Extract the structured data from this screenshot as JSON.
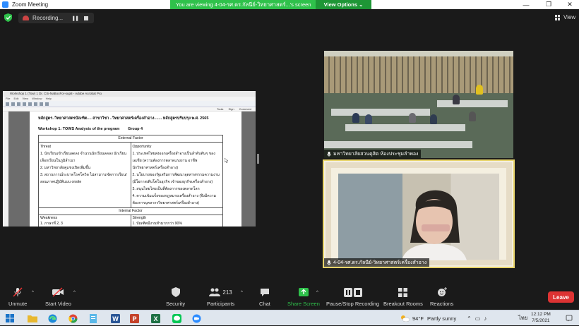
{
  "window": {
    "title": "Zoom Meeting"
  },
  "window_controls": {
    "minimize": "—",
    "restore": "❐",
    "close": "✕"
  },
  "share_banner": {
    "text": "You are viewing 4-04-รศ.ดร.กัลนีย์-วิทยาศาสตร์...'s screen",
    "view_options": "View Options ⌄"
  },
  "recording": {
    "label": "Recording..."
  },
  "view_button": {
    "label": "View"
  },
  "shared_document": {
    "app_title": "Workshop 1 (Tow) 1 Dr. CSi-NaBoxFor-sup8 - Adobe Acrobat Pro",
    "menu": "File Edit View Window Help",
    "tools_bar": "Tools Sign Comment",
    "heading": "หลักสูตร..วิทยาศาสตรบัณฑิต....  สาขาวิชา ..วิทยาศาสตร์เครื่องสำอาง.......  หลักสูตรปรับปรุง พ.ศ. 2565",
    "workshop_title": "Workshop 1: TOWS Analysis of the program",
    "group": "Group 4",
    "external_factor": "External Factor",
    "internal_factor": "Internal Factor",
    "threat_title": "Threat",
    "threat_items": [
      "1. นักเรียนเข้าเรียนลดลง จำนวนนักเรียนลดลง นักเรียน",
      "เลือกเรียนในภูมิลำเนา",
      "2. มหาวิทยาลัยคู่แข่งเปิดเพิ่มขึ้น",
      "3. สถานการณ์ระบาดโรคโควิด ไม่สามารถจัดการเรียน/",
      "สอนภาคปฏิบัติแบบ onsite"
    ],
    "opportunity_title": "Opportunity",
    "opportunity_items": [
      "1. ประเทศไทยส่งออกเครื่องสำอางเป็นลำดับต้นๆ ของ",
      "เอเชีย (ความต้องการตลาดแรงงาน อาชีพ",
      "นักวิทยาศาสตร์เครื่องสำอาง)",
      "2. นโยบายของรัฐเสริมการพัฒนาอุตสาหกรรมความงาม",
      "(มีโอกาสเติบโตในธุรกิจ เจ้าของธุรกิจเครื่องสำอาง)",
      "3. สนุนไทยไทยเป็นที่ต้องการของตลาดโลก",
      "4. ความเข้มแข็งของกฎหมายเครื่องสำอาง (จึงมีความ",
      "ต้องการบุคลากรวิทยาศาสตร์เครื่องสำอาง)"
    ],
    "weakness_title": "Weakness",
    "weakness_first": "1. ภาษาที่ 2, 3",
    "strength_title": "Strength",
    "strength_first": "1. บัณฑิตมีงานทำมากกว่า 90%"
  },
  "participants_video": [
    {
      "name": "มหาวิทยาลัยสวนดุสิต ห้องประชุมลำพอง"
    },
    {
      "name": "4-04-รศ.ดร.กัลนีย์-วิทยาศาสตร์เครื่องสำอาง"
    }
  ],
  "toolbar": {
    "unmute": "Unmute",
    "start_video": "Start Video",
    "security": "Security",
    "participants": "Participants",
    "participants_count": "213",
    "chat": "Chat",
    "share_screen": "Share Screen",
    "recording": "Pause/Stop Recording",
    "breakout": "Breakout Rooms",
    "reactions": "Reactions",
    "leave": "Leave"
  },
  "taskbar": {
    "weather_temp": "94°F",
    "weather_desc": "Partly sunny",
    "language": "ไทย",
    "time": "12:12 PM",
    "date": "7/5/2021"
  },
  "colors": {
    "zoom_green": "#2fc14b",
    "leave_red": "#dd3333",
    "meeting_bg": "#1a1a1a",
    "speaker_frame": "#e8d46a"
  }
}
